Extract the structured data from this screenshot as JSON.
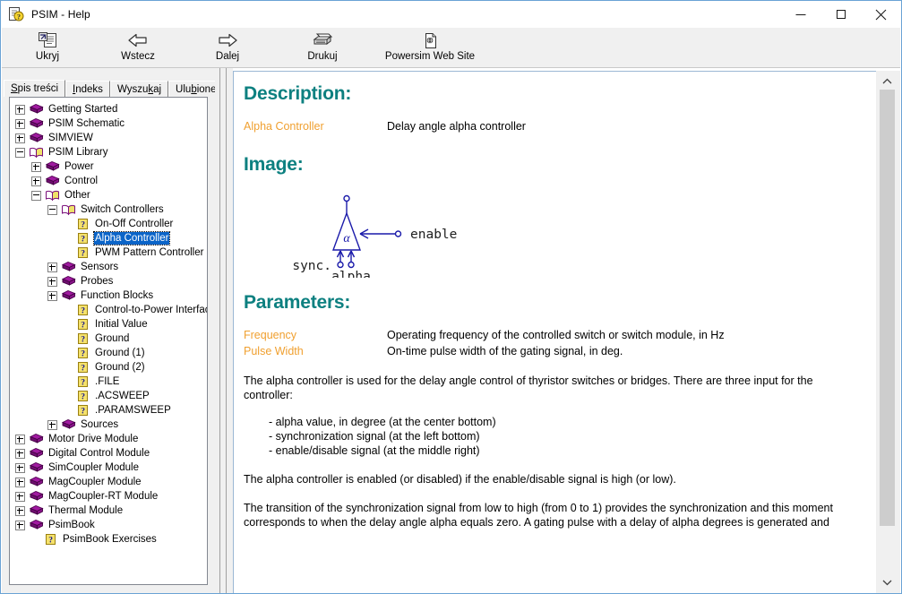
{
  "window": {
    "title": "PSIM - Help",
    "icon": "help-document-icon",
    "minimize": "—",
    "maximize": "□",
    "close": "✕"
  },
  "toolbar": {
    "buttons": [
      {
        "label": "Ukryj",
        "icon": "hide-pane-icon"
      },
      {
        "label": "Wstecz",
        "icon": "arrow-left-icon"
      },
      {
        "label": "Dalej",
        "icon": "arrow-right-icon"
      },
      {
        "label": "Drukuj",
        "icon": "printer-icon"
      },
      {
        "label": "Powersim Web Site",
        "icon": "web-page-icon"
      }
    ]
  },
  "tabs": [
    {
      "label": "Spis treści",
      "accel": "S",
      "active": true
    },
    {
      "label": "Indeks",
      "accel": "I",
      "active": false
    },
    {
      "label": "Wyszukaj",
      "accel": "k",
      "active": false
    },
    {
      "label": "Ulubione",
      "accel": "b",
      "active": false
    }
  ],
  "tree": [
    {
      "label": "Getting Started",
      "depth": 0,
      "toggle": "plus",
      "icon": "book-closed-icon",
      "selected": false
    },
    {
      "label": "PSIM Schematic",
      "depth": 0,
      "toggle": "plus",
      "icon": "book-closed-icon",
      "selected": false
    },
    {
      "label": "SIMVIEW",
      "depth": 0,
      "toggle": "plus",
      "icon": "book-closed-icon",
      "selected": false
    },
    {
      "label": "PSIM Library",
      "depth": 0,
      "toggle": "minus",
      "icon": "book-open-icon",
      "selected": false
    },
    {
      "label": "Power",
      "depth": 1,
      "toggle": "plus",
      "icon": "book-closed-icon",
      "selected": false
    },
    {
      "label": "Control",
      "depth": 1,
      "toggle": "plus",
      "icon": "book-closed-icon",
      "selected": false
    },
    {
      "label": "Other",
      "depth": 1,
      "toggle": "minus",
      "icon": "book-open-icon",
      "selected": false
    },
    {
      "label": "Switch Controllers",
      "depth": 2,
      "toggle": "minus",
      "icon": "book-open-icon",
      "selected": false
    },
    {
      "label": "On-Off Controller",
      "depth": 3,
      "toggle": "none",
      "icon": "help-topic-icon",
      "selected": false
    },
    {
      "label": "Alpha Controller",
      "depth": 3,
      "toggle": "none",
      "icon": "help-topic-icon",
      "selected": true
    },
    {
      "label": "PWM Pattern Controller",
      "depth": 3,
      "toggle": "none",
      "icon": "help-topic-icon",
      "selected": false
    },
    {
      "label": "Sensors",
      "depth": 2,
      "toggle": "plus",
      "icon": "book-closed-icon",
      "selected": false
    },
    {
      "label": "Probes",
      "depth": 2,
      "toggle": "plus",
      "icon": "book-closed-icon",
      "selected": false
    },
    {
      "label": "Function Blocks",
      "depth": 2,
      "toggle": "plus",
      "icon": "book-closed-icon",
      "selected": false
    },
    {
      "label": "Control-to-Power Interface",
      "depth": 3,
      "toggle": "none",
      "icon": "help-topic-icon",
      "selected": false
    },
    {
      "label": "Initial Value",
      "depth": 3,
      "toggle": "none",
      "icon": "help-topic-icon",
      "selected": false
    },
    {
      "label": "Ground",
      "depth": 3,
      "toggle": "none",
      "icon": "help-topic-icon",
      "selected": false
    },
    {
      "label": "Ground (1)",
      "depth": 3,
      "toggle": "none",
      "icon": "help-topic-icon",
      "selected": false
    },
    {
      "label": "Ground (2)",
      "depth": 3,
      "toggle": "none",
      "icon": "help-topic-icon",
      "selected": false
    },
    {
      "label": ".FILE",
      "depth": 3,
      "toggle": "none",
      "icon": "help-topic-icon",
      "selected": false
    },
    {
      "label": ".ACSWEEP",
      "depth": 3,
      "toggle": "none",
      "icon": "help-topic-icon",
      "selected": false
    },
    {
      "label": ".PARAMSWEEP",
      "depth": 3,
      "toggle": "none",
      "icon": "help-topic-icon",
      "selected": false
    },
    {
      "label": "Sources",
      "depth": 2,
      "toggle": "plus",
      "icon": "book-closed-icon",
      "selected": false
    },
    {
      "label": "Motor Drive Module",
      "depth": 0,
      "toggle": "plus",
      "icon": "book-closed-icon",
      "selected": false
    },
    {
      "label": "Digital Control Module",
      "depth": 0,
      "toggle": "plus",
      "icon": "book-closed-icon",
      "selected": false
    },
    {
      "label": "SimCoupler Module",
      "depth": 0,
      "toggle": "plus",
      "icon": "book-closed-icon",
      "selected": false
    },
    {
      "label": "MagCoupler Module",
      "depth": 0,
      "toggle": "plus",
      "icon": "book-closed-icon",
      "selected": false
    },
    {
      "label": "MagCoupler-RT Module",
      "depth": 0,
      "toggle": "plus",
      "icon": "book-closed-icon",
      "selected": false
    },
    {
      "label": "Thermal Module",
      "depth": 0,
      "toggle": "plus",
      "icon": "book-closed-icon",
      "selected": false
    },
    {
      "label": "PsimBook",
      "depth": 0,
      "toggle": "plus",
      "icon": "book-closed-icon",
      "selected": false
    },
    {
      "label": "PsimBook Exercises",
      "depth": 1,
      "toggle": "none",
      "icon": "help-topic-icon",
      "selected": false
    }
  ],
  "content": {
    "heading_description": "Description:",
    "description_term": "Alpha Controller",
    "description_text": "Delay angle alpha controller",
    "heading_image": "Image:",
    "figure": {
      "label_enable": "enable",
      "label_sync": "sync.",
      "label_alpha": "alpha",
      "label_symbol": "α",
      "color": "#1a1aaa"
    },
    "heading_parameters": "Parameters:",
    "parameters": [
      {
        "term": "Frequency",
        "desc": "Operating frequency of the controlled switch or switch module, in Hz"
      },
      {
        "term": "Pulse Width",
        "desc": "On-time pulse width of the gating signal, in deg."
      }
    ],
    "para1": "The alpha controller is used for the delay angle control of thyristor switches or bridges. There are three input for the controller:",
    "bullets": [
      "- alpha value, in degree (at the center bottom)",
      "- synchronization signal (at the left bottom)",
      "- enable/disable signal (at the middle right)"
    ],
    "para2": "The alpha controller is enabled (or disabled) if the enable/disable signal is high (or low).",
    "para3": "The transition of the synchronization signal from low to high (from 0 to 1) provides the synchronization and this moment corresponds to when the delay angle alpha equals zero. A gating pulse with a delay of alpha degrees is generated and"
  },
  "colors": {
    "heading": "#0d8080",
    "term": "#f0a030",
    "selection": "#0a64c8",
    "window_border": "#6aa3d5"
  }
}
